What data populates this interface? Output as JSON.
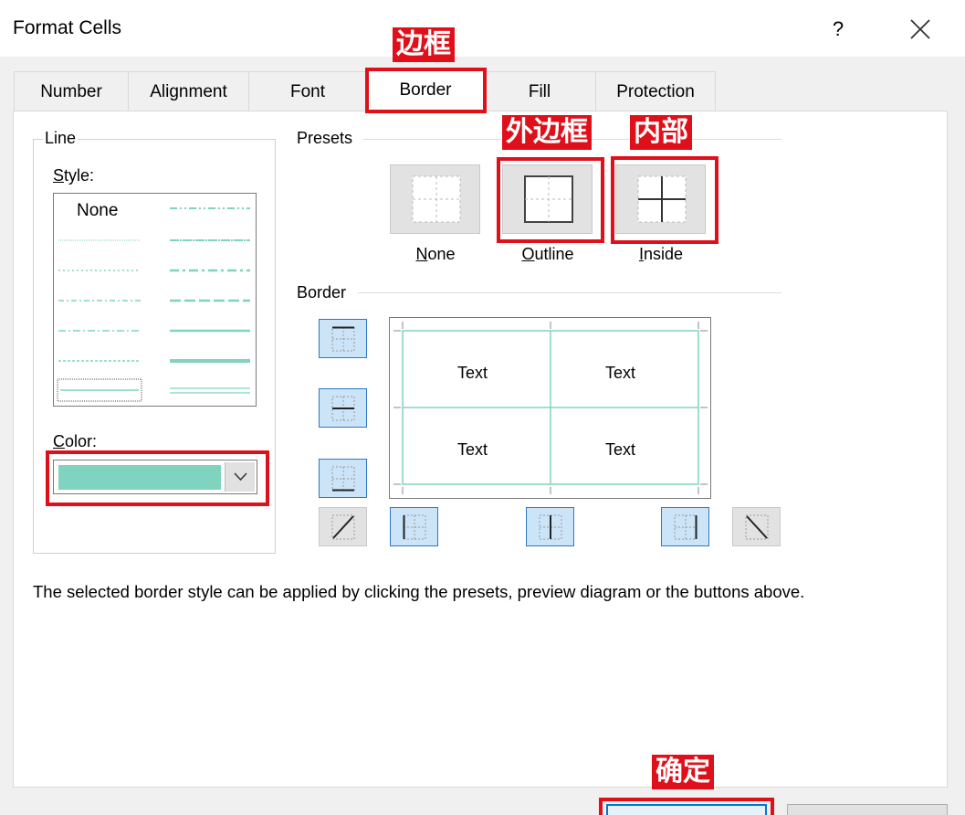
{
  "window": {
    "title": "Format Cells",
    "help_label": "?"
  },
  "tabs": [
    {
      "label": "Number"
    },
    {
      "label": "Alignment"
    },
    {
      "label": "Font"
    },
    {
      "label": "Border",
      "active": true
    },
    {
      "label": "Fill"
    },
    {
      "label": "Protection"
    }
  ],
  "line_group": {
    "title": "Line",
    "style_label_first": "S",
    "style_label_rest": "tyle:",
    "style_none": "None",
    "color_label_first": "C",
    "color_label_rest": "olor:",
    "color_value": "#80d3bf"
  },
  "presets": {
    "title": "Presets",
    "items": [
      {
        "key_letter": "N",
        "rest": "one"
      },
      {
        "key_letter": "O",
        "rest": "utline"
      },
      {
        "key_letter": "I",
        "rest": "nside"
      }
    ]
  },
  "border": {
    "title": "Border",
    "preview_cells": [
      "Text",
      "Text",
      "Text",
      "Text"
    ]
  },
  "description": "The selected border style can be applied by clicking the presets, preview diagram or the buttons above.",
  "annotations": {
    "border_tab": "边框",
    "outline": "外边框",
    "inside": "内部",
    "ok": "确定"
  },
  "colors": {
    "accent": "#80d3bf",
    "highlight": "#e0101b",
    "selected_blue": "#2c78c8"
  }
}
